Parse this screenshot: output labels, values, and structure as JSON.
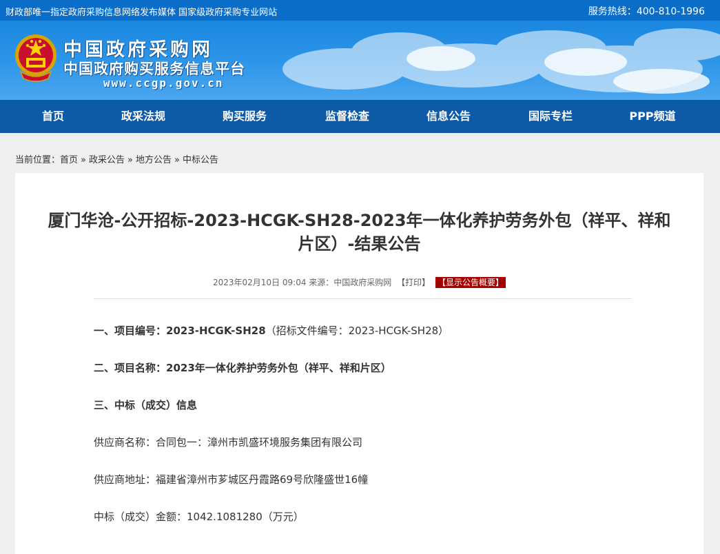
{
  "topbar": {
    "left_text": "财政部唯一指定政府采购信息网络发布媒体 国家级政府采购专业网站",
    "hotline_label": "服务热线：",
    "hotline_number": "400-810-1996"
  },
  "brand": {
    "line1": "中国政府采购网",
    "line2": "中国政府购买服务信息平台",
    "url": "www.ccgp.gov.cn"
  },
  "nav": {
    "items": [
      "首页",
      "政采法规",
      "购买服务",
      "监督检查",
      "信息公告",
      "国际专栏",
      "PPP频道"
    ]
  },
  "breadcrumb": {
    "label": "当前位置：",
    "items": [
      "首页",
      "政采公告",
      "地方公告",
      "中标公告"
    ],
    "separator": "»"
  },
  "article": {
    "title_line1": "厦门华沧-公开招标-2023-HCGK-SH28-2023年一体化养护劳务外包（祥平、祥和",
    "title_line2": "片区）-结果公告",
    "date": "2023年02月10日 09:04",
    "source": "来源：中国政府采购网",
    "print_label": "【打印】",
    "summary_label": "【显示公告概要】",
    "sections": {
      "project_no_label": "一、项目编号：",
      "project_no_value": "2023-HCGK-SH28",
      "project_no_note": "（招标文件编号：2023-HCGK-SH28）",
      "project_name_label": "二、项目名称：",
      "project_name_value": "2023年一体化养护劳务外包（祥平、祥和片区）",
      "award_heading": "三、中标（成交）信息",
      "supplier_name": "供应商名称：合同包一：漳州市凯盛环境服务集团有限公司",
      "supplier_address": "供应商地址：福建省漳州市芗城区丹霞路69号欣隆盛世16幢",
      "amount": "中标（成交）金额：1042.1081280（万元）"
    }
  },
  "colors": {
    "topbar": "#0a6ec9",
    "nav": "#0d5aa7",
    "summary_badge": "#a40000"
  }
}
